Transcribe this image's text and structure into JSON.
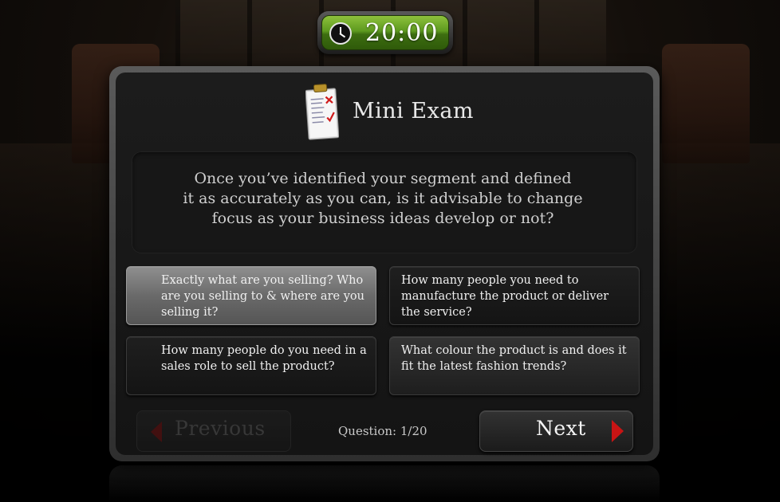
{
  "timer": {
    "time": "20:00",
    "icon": "clock-icon"
  },
  "exam": {
    "title": "Mini Exam",
    "icon": "clipboard-icon"
  },
  "question": {
    "line1": "Once you’ve identified your segment and defined",
    "line2": "it as accurately as you can, is it advisable to change",
    "line3": "focus as your business ideas develop or not?"
  },
  "answers": [
    {
      "text": "Exactly what are you selling? Who are you selling to & where are you selling it?",
      "selected": true
    },
    {
      "text": "How many people you need to manufacture the product or deliver the service?",
      "selected": false
    },
    {
      "text": "How many people do you need in a sales role to sell the product?",
      "selected": false
    },
    {
      "text": "What colour the product is and does it fit the latest fashion trends?",
      "selected": false
    }
  ],
  "nav": {
    "previous_label": "Previous",
    "next_label": "Next",
    "question_counter": "Question: 1/20"
  },
  "colors": {
    "timer_green": "#5e9a1f",
    "arrow_red": "#c81414",
    "selected_answer": "#7a7a7a"
  }
}
